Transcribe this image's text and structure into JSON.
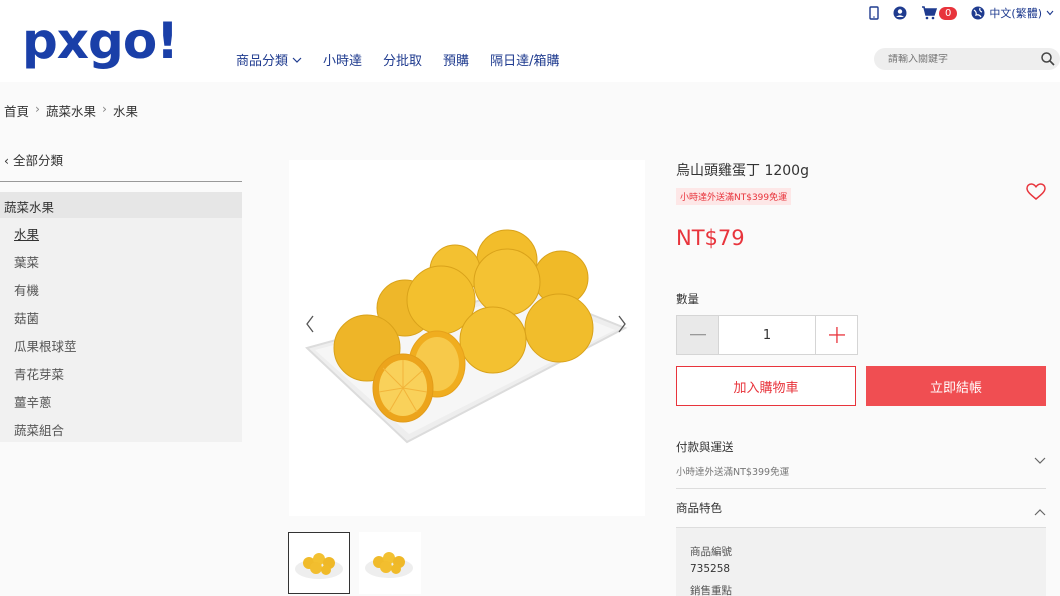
{
  "brand": {
    "logo": "pxgo!"
  },
  "nav": {
    "items": [
      "商品分類",
      "小時達",
      "分批取",
      "預購",
      "隔日達/箱購"
    ],
    "dropdown_marker": "⌄"
  },
  "topbar": {
    "cart_count": "0",
    "language": "中文(繁體)"
  },
  "search": {
    "placeholder": "請輸入關鍵字"
  },
  "breadcrumb": [
    "首頁",
    "蔬菜水果",
    "水果"
  ],
  "sidebar": {
    "back_label": "全部分類",
    "category": "蔬菜水果",
    "items": [
      "水果",
      "葉菜",
      "有機",
      "菇菌",
      "瓜果根球莖",
      "青花芽菜",
      "薑辛蔥",
      "蔬菜組合"
    ]
  },
  "product": {
    "title": "烏山頭雞蛋丁 1200g",
    "tag": "小時達外送滿NT$399免運",
    "price": "NT$79",
    "quantity_label": "數量",
    "quantity": "1",
    "add_to_cart": "加入購物車",
    "checkout": "立即結帳",
    "payment_title": "付款與運送",
    "payment_sub": "小時達外送滿NT$399免運",
    "features_title": "商品特色",
    "spec_label_1": "商品編號",
    "spec_value_1": "735258",
    "spec_label_2": "銷售重點"
  },
  "colors": {
    "brand": "#1a3fa8",
    "accent": "#e8343c"
  }
}
